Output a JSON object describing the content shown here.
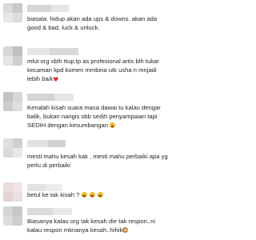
{
  "comments": [
    {
      "avatar_colors": [
        "#d9d9d9",
        "#c9c9c9",
        "#e7e7e7",
        "#dcdcdc"
      ],
      "username_colors": [
        "#d6d6d6",
        "#e6e6e6"
      ],
      "lines": [
        "biasala. hidup akan ada ups & downs. akan ada",
        "good & bad, luck & unluck."
      ]
    },
    {
      "avatar_colors": [
        "#d7d7d7",
        "#bfbfbf",
        "#e4e4e4",
        "#cfcfcf"
      ],
      "username_colors": [
        "#e6e6e6",
        "#d8d8d8"
      ],
      "lines": [
        "mlut org xblh ttup,tp as profesional artis blh tukar",
        "kecaman kpd komen mmbina utk usha n mnjadi",
        "lebih baik"
      ],
      "trailing_icon": "red-heart-icon"
    },
    {
      "avatar_colors": [
        "#c3c3c3",
        "#d6d6d6",
        "#cccccc",
        "#dedede"
      ],
      "username_colors": [
        "#d4d4d4",
        "#e5e5e5"
      ],
      "lines": [
        "Kenalah kisah suara masa dawai tu kalau dengar",
        "balik, bukan nangis sbb sedih penyampaian tapi",
        "SEDIH dengan kesumbangan"
      ],
      "trailing_icon": "weary-face-icon"
    },
    {
      "avatar_colors": [
        "#dedede",
        "#cfcfcf",
        "#d9d9d9",
        "#e8e8e8"
      ],
      "username_colors": [
        "#e1e1e1",
        "#d2d2d2"
      ],
      "lines": [
        "mesti mahu kesah kak , mesti mahu perbaiki apa yg",
        "perlu di perbaiki"
      ]
    },
    {
      "avatar_colors": [
        "#e9dcdc",
        "#f0e4e4",
        "#e3d3d3",
        "#ece0e0"
      ],
      "username_colors": [
        "#e3e3e3",
        "#ececec"
      ],
      "lines": [
        "betul ke tak kisah ?"
      ],
      "trailing_icons": [
        "laughing-face-icon",
        "laughing-face-icon",
        "laughing-face-icon"
      ]
    },
    {
      "avatar_colors": [
        "#d5d5d5",
        "#c7c7c7",
        "#dcdcdc",
        "#cdcdcd"
      ],
      "username_colors": [
        "#dadada",
        "#e7e7e7"
      ],
      "lines": [
        "Biasanya kalau org tak kesah die tak respon..ni",
        "kalau respon mknanya kesah..hihik"
      ],
      "trailing_icon": "see-no-evil-monkey-icon"
    }
  ]
}
